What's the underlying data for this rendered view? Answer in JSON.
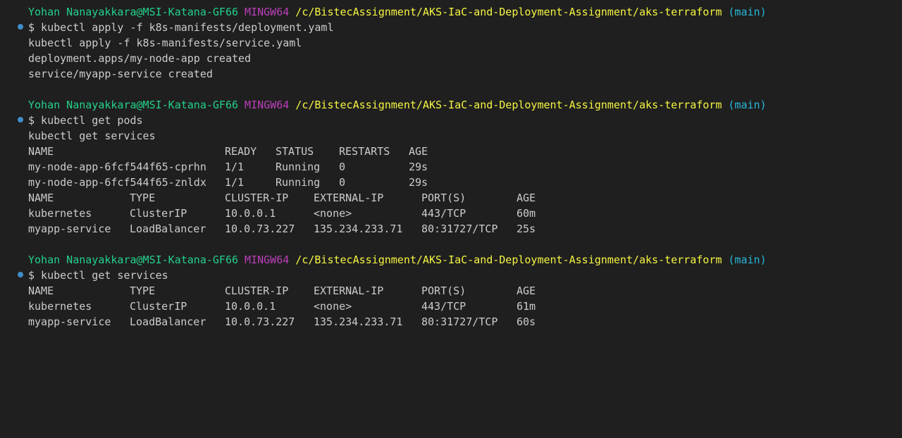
{
  "prompt": {
    "user_host": "Yohan Nanayakkara@MSI-Katana-GF66",
    "env": "MINGW64",
    "path": "/c/BistecAssignment/AKS-IaC-and-Deployment-Assignment/aks-terraform",
    "branch": "(main)"
  },
  "colors": {
    "background": "#1f1f1f",
    "text": "#cccccc",
    "user": "#23d18b",
    "env": "#bc3fbc",
    "path": "#f5f543",
    "branch": "#29b8db",
    "dot": "#3f8ec9"
  },
  "blocks": [
    {
      "command1": "$ kubectl apply -f k8s-manifests/deployment.yaml",
      "command2": "kubectl apply -f k8s-manifests/service.yaml",
      "out1": "deployment.apps/my-node-app created",
      "out2": "service/myapp-service created"
    },
    {
      "command1": "$ kubectl get pods",
      "command2": "kubectl get services",
      "pods": {
        "headers": [
          "NAME",
          "READY",
          "STATUS",
          "RESTARTS",
          "AGE"
        ],
        "rows": [
          [
            "my-node-app-6fcf544f65-cprhn",
            "1/1",
            "Running",
            "0",
            "29s"
          ],
          [
            "my-node-app-6fcf544f65-znldx",
            "1/1",
            "Running",
            "0",
            "29s"
          ]
        ]
      },
      "services": {
        "headers": [
          "NAME",
          "TYPE",
          "CLUSTER-IP",
          "EXTERNAL-IP",
          "PORT(S)",
          "AGE"
        ],
        "rows": [
          [
            "kubernetes",
            "ClusterIP",
            "10.0.0.1",
            "<none>",
            "443/TCP",
            "60m"
          ],
          [
            "myapp-service",
            "LoadBalancer",
            "10.0.73.227",
            "135.234.233.71",
            "80:31727/TCP",
            "25s"
          ]
        ]
      }
    },
    {
      "command1": "$ kubectl get services",
      "services": {
        "headers": [
          "NAME",
          "TYPE",
          "CLUSTER-IP",
          "EXTERNAL-IP",
          "PORT(S)",
          "AGE"
        ],
        "rows": [
          [
            "kubernetes",
            "ClusterIP",
            "10.0.0.1",
            "<none>",
            "443/TCP",
            "61m"
          ],
          [
            "myapp-service",
            "LoadBalancer",
            "10.0.73.227",
            "135.234.233.71",
            "80:31727/TCP",
            "60s"
          ]
        ]
      }
    }
  ]
}
